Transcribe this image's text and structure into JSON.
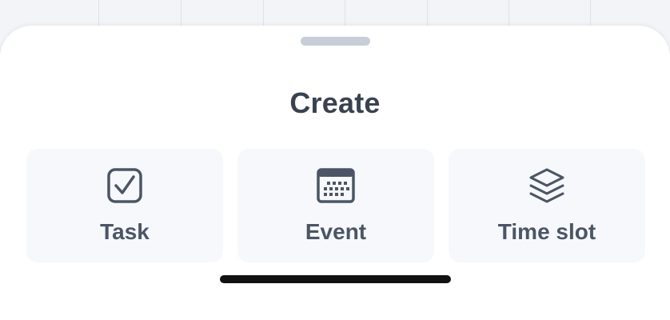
{
  "sheet": {
    "title": "Create"
  },
  "options": [
    {
      "label": "Task",
      "icon": "checkbox-icon"
    },
    {
      "label": "Event",
      "icon": "calendar-icon"
    },
    {
      "label": "Time slot",
      "icon": "layers-icon"
    }
  ],
  "colors": {
    "title": "#3a4250",
    "label": "#4b5565",
    "card_bg": "#f6f8fb",
    "handle": "#c7ced8",
    "home_indicator": "#111111"
  }
}
